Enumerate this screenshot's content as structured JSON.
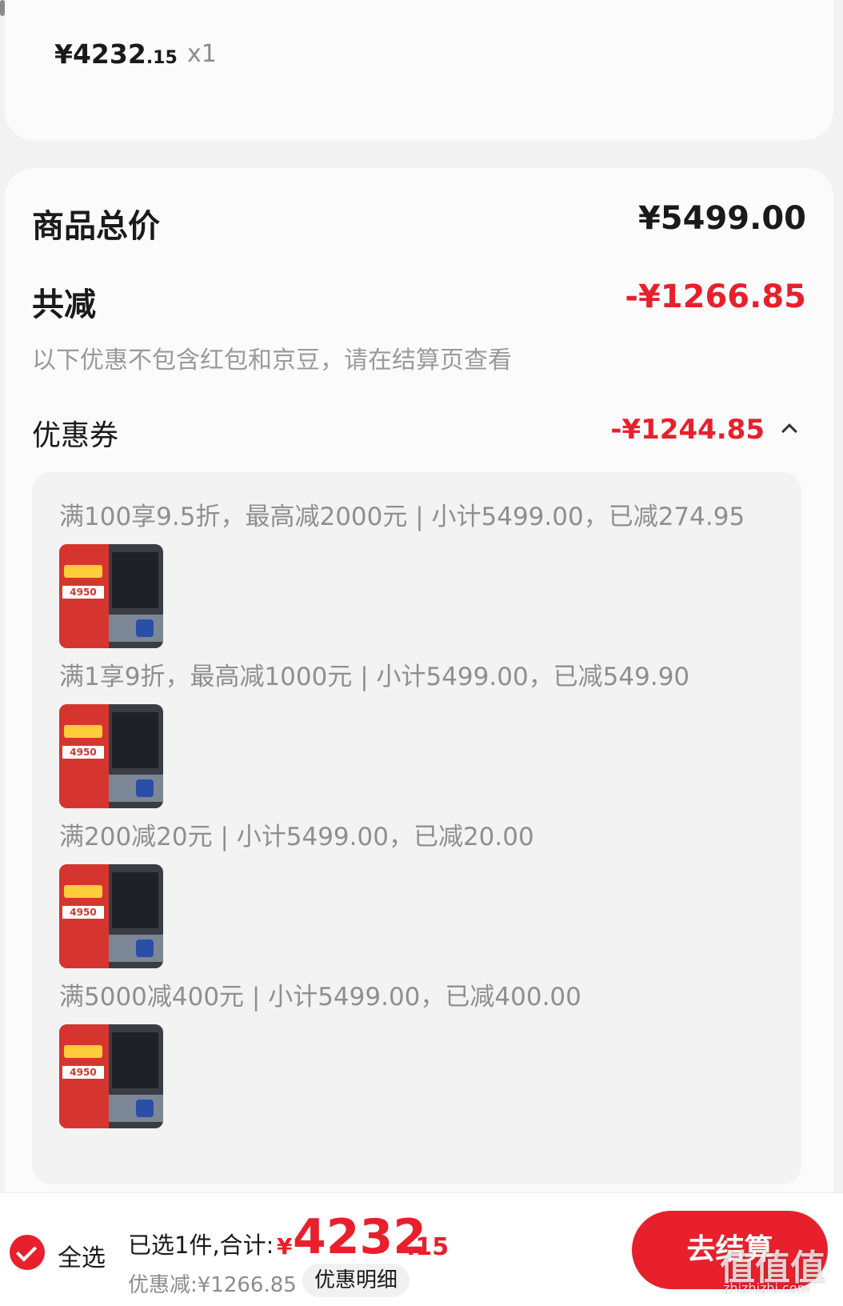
{
  "product": {
    "price_int": "¥4232",
    "price_dec": ".15",
    "quantity": "x1"
  },
  "summary": {
    "total_label": "商品总价",
    "total_value": "¥5499.00",
    "reduction_label": "共减",
    "reduction_value": "-¥1266.85",
    "note": "以下优惠不包含红包和京豆，请在结算页查看",
    "coupon_label": "优惠券",
    "coupon_value": "-¥1244.85"
  },
  "coupon_rules": [
    {
      "text": "满100享9.5折，最高减2000元 | 小计5499.00，已减274.95",
      "thumb_price": "4950"
    },
    {
      "text": "满1享9折，最高减1000元 | 小计5499.00，已减549.90",
      "thumb_price": "4950"
    },
    {
      "text": "满200减20元 | 小计5499.00，已减20.00",
      "thumb_price": "4950"
    },
    {
      "text": "满5000减400元 | 小计5499.00，已减400.00",
      "thumb_price": "4950"
    }
  ],
  "bottom_bar": {
    "select_all": "全选",
    "selected_summary": "已选1件,合计:",
    "total_yen": "¥",
    "total_int": "4232",
    "total_dec": ".15",
    "discount_text": "优惠减:¥1266.85",
    "detail_button": "优惠明细",
    "checkout_button": "去结算"
  },
  "watermark": {
    "text": "值值值",
    "sub": "zhizhizhi.com"
  },
  "colors": {
    "accent_red": "#e8202c",
    "page_bg": "#f2f2f2",
    "card_bg": "#fbfbfb"
  }
}
